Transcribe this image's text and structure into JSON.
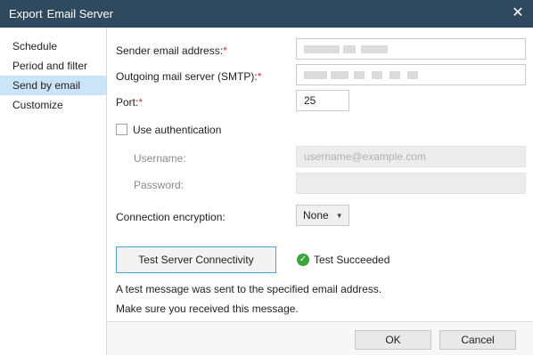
{
  "titlebar": {
    "title_prefix": "Export",
    "title_main": "Email Server",
    "close_symbol": "✕"
  },
  "sidebar": {
    "items": [
      {
        "label": "Schedule",
        "active": false
      },
      {
        "label": "Period and filter",
        "active": false
      },
      {
        "label": "Send by email",
        "active": true
      },
      {
        "label": "Customize",
        "active": false
      }
    ]
  },
  "form": {
    "sender_label": "Sender email address:",
    "smtp_label": "Outgoing mail server (SMTP):",
    "port_label": "Port:",
    "port_value": "25",
    "required_mark": "*",
    "use_auth_label": "Use authentication",
    "username_label": "Username:",
    "username_placeholder": "username@example.com",
    "password_label": "Password:",
    "encryption_label": "Connection encryption:",
    "encryption_value": "None"
  },
  "test": {
    "button_label": "Test Server Connectivity",
    "status_text": "Test Succeeded",
    "message_line1": "A test message was sent to the specified email address.",
    "message_line2": "Make sure you received this message."
  },
  "footer": {
    "ok_label": "OK",
    "cancel_label": "Cancel"
  },
  "colors": {
    "titlebar": "#2f4a5f",
    "active_item": "#cce4f7",
    "required": "#d9362b",
    "success": "#3aa43a",
    "focus_border": "#4aa3df"
  }
}
